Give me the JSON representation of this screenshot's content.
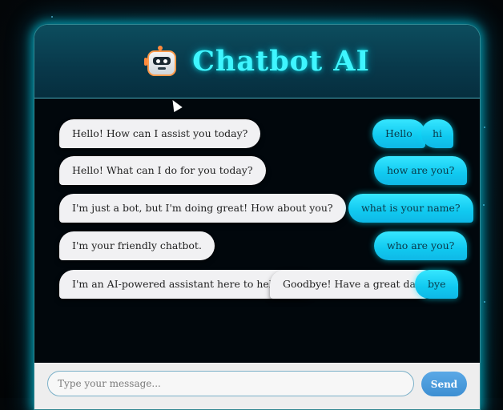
{
  "header": {
    "title": "Chatbot AI",
    "icon": "robot-icon"
  },
  "messages": {
    "bot": [
      "Hello! How can I assist you today?",
      "Hello! What can I do for you today?",
      "I'm just a bot, but I'm doing great! How about you?",
      "I'm your friendly chatbot.",
      "I'm an AI-powered assistant here to help you.",
      "Goodbye! Have a great day!"
    ],
    "user": [
      "Hello",
      "hi",
      "how are you?",
      "what is your name?",
      "who are you?",
      "bye"
    ]
  },
  "input": {
    "placeholder": "Type your message...",
    "value": ""
  },
  "send_label": "Send",
  "colors": {
    "accent": "#3ff5ff",
    "user_bubble": "#1fd4f5",
    "bot_bubble": "#f1f1f3",
    "send": "#4a9bdc"
  }
}
